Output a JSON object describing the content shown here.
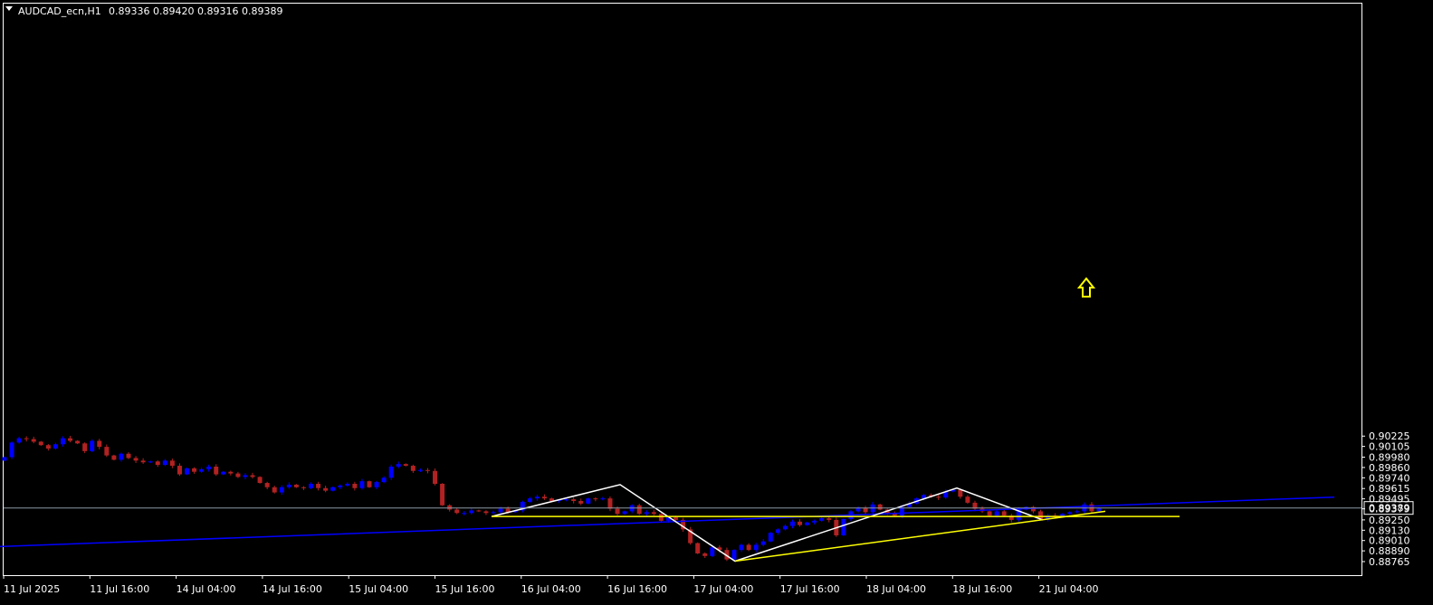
{
  "header": {
    "symbol": "AUDCAD_ecn,H1",
    "ohlc": "0.89336 0.89420 0.89316 0.89389"
  },
  "colors": {
    "background": "#000000",
    "frame": "#ffffff",
    "bull_candle": "#0000ff",
    "bear_candle": "#b22222",
    "trendline": "#0000ff",
    "pattern_line": "#ffffff",
    "support_line": "#ffff00",
    "arrow": "#ffff00",
    "bid_line": "#8c9aa6"
  },
  "chart_data": {
    "type": "candlestick",
    "ylim": [
      0.8872,
      0.903
    ],
    "y_ticks": [
      "0.90225",
      "0.90105",
      "0.89980",
      "0.89860",
      "0.89740",
      "0.89615",
      "0.89495",
      "0.89379",
      "0.89250",
      "0.89130",
      "0.89010",
      "0.88890",
      "0.88765"
    ],
    "x_ticks": [
      "11 Jul 2025",
      "11 Jul 16:00",
      "14 Jul 04:00",
      "14 Jul 16:00",
      "15 Jul 04:00",
      "15 Jul 16:00",
      "16 Jul 04:00",
      "16 Jul 16:00",
      "17 Jul 04:00",
      "17 Jul 16:00",
      "18 Jul 04:00",
      "18 Jul 16:00",
      "21 Jul 04:00"
    ],
    "current_price": "0.89389",
    "closes": [
      0.8998,
      0.9015,
      0.902,
      0.9019,
      0.9016,
      0.9012,
      0.9008,
      0.9013,
      0.902,
      0.9017,
      0.9014,
      0.9005,
      0.9017,
      0.901,
      0.9,
      0.8995,
      0.9002,
      0.8997,
      0.8994,
      0.8992,
      0.8993,
      0.8989,
      0.8994,
      0.8988,
      0.8978,
      0.8985,
      0.8981,
      0.8984,
      0.8987,
      0.8978,
      0.8981,
      0.8979,
      0.8975,
      0.8977,
      0.8975,
      0.8968,
      0.8963,
      0.8957,
      0.8963,
      0.8966,
      0.8963,
      0.8962,
      0.8967,
      0.8962,
      0.8959,
      0.8963,
      0.8965,
      0.8967,
      0.8962,
      0.897,
      0.8963,
      0.8969,
      0.8974,
      0.8987,
      0.899,
      0.8988,
      0.8982,
      0.8983,
      0.8982,
      0.8967,
      0.8942,
      0.8937,
      0.8933,
      0.8933,
      0.8936,
      0.8935,
      0.8933,
      0.8934,
      0.8938,
      0.8934,
      0.8936,
      0.8946,
      0.895,
      0.8952,
      0.895,
      0.8947,
      0.8948,
      0.8949,
      0.8947,
      0.8944,
      0.895,
      0.8949,
      0.895,
      0.8938,
      0.8932,
      0.8935,
      0.8942,
      0.8932,
      0.8934,
      0.8932,
      0.8924,
      0.8928,
      0.8925,
      0.8914,
      0.8898,
      0.8886,
      0.8883,
      0.8893,
      0.889,
      0.8879,
      0.889,
      0.8896,
      0.889,
      0.8896,
      0.89,
      0.891,
      0.8914,
      0.8918,
      0.8923,
      0.8919,
      0.8922,
      0.8924,
      0.8927,
      0.8925,
      0.8907,
      0.8926,
      0.8935,
      0.8939,
      0.8934,
      0.8943,
      0.8937,
      0.8933,
      0.893,
      0.894,
      0.8944,
      0.895,
      0.8954,
      0.8952,
      0.8951,
      0.8958,
      0.896,
      0.8952,
      0.8945,
      0.8938,
      0.8935,
      0.893,
      0.8935,
      0.893,
      0.8925,
      0.8937,
      0.894,
      0.8935,
      0.8926,
      0.893,
      0.8929,
      0.8932,
      0.8934,
      0.8935,
      0.8943,
      0.8935,
      0.8939
    ],
    "overlays": {
      "blue_trendline": [
        [
          0,
          0.8894
        ],
        [
          1474,
          0.89515
        ]
      ],
      "pattern_zigzag": [
        [
          543,
          0.8929
        ],
        [
          685,
          0.8966
        ],
        [
          812,
          0.8877
        ],
        [
          1057,
          0.8962
        ],
        [
          1152,
          0.8925
        ]
      ],
      "neckline": [
        [
          543,
          0.8929
        ],
        [
          1303,
          0.8929
        ]
      ],
      "rising_support": [
        [
          812,
          0.8877
        ],
        [
          1221,
          0.8935
        ]
      ]
    }
  }
}
